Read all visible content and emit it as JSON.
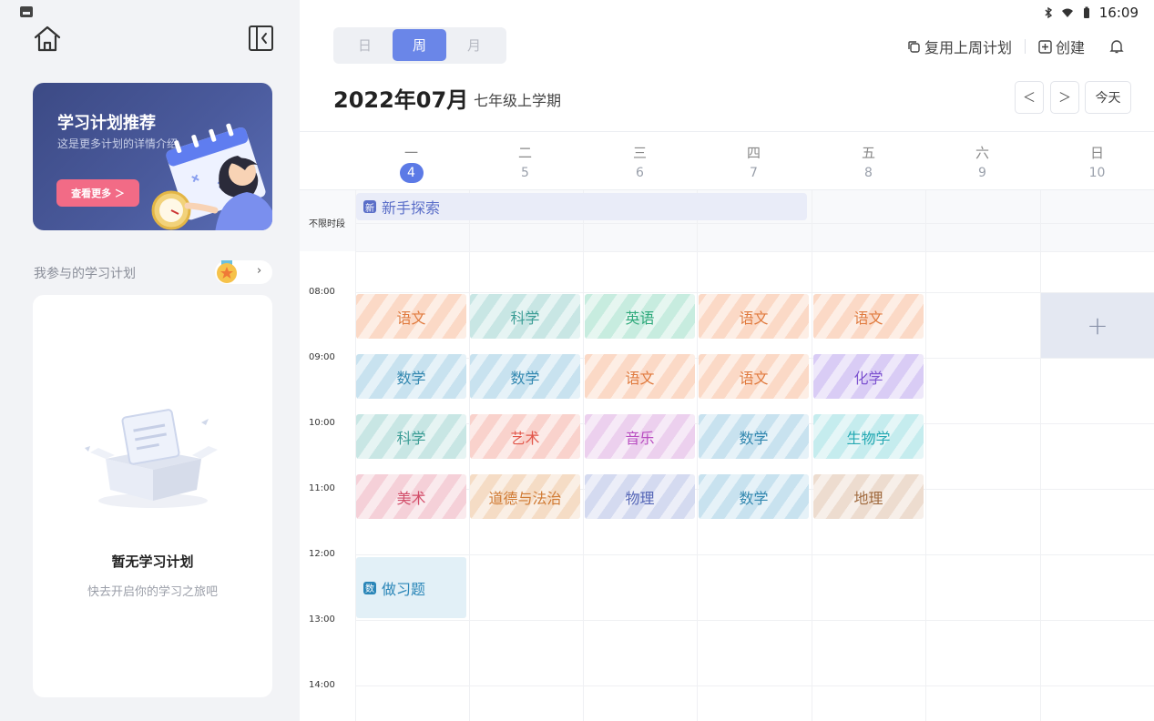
{
  "sidebar": {
    "banner": {
      "title": "学习计划推荐",
      "subtitle": "这是更多计划的详情介绍",
      "button": "查看更多 ＞"
    },
    "my_plans_label": "我参与的学习计划",
    "empty": {
      "title": "暂无学习计划",
      "subtitle": "快去开启你的学习之旅吧"
    }
  },
  "status": {
    "time": "16:09"
  },
  "view_tabs": [
    "日",
    "周",
    "月"
  ],
  "active_view": "周",
  "actions": {
    "reuse": "复用上周计划",
    "create": "创建"
  },
  "header": {
    "month": "2022年07月",
    "term": "七年级上学期",
    "prev": "＜",
    "next": "＞",
    "today": "今天"
  },
  "days": [
    {
      "name": "一",
      "num": "4",
      "today": true
    },
    {
      "name": "二",
      "num": "5"
    },
    {
      "name": "三",
      "num": "6"
    },
    {
      "name": "四",
      "num": "7"
    },
    {
      "name": "五",
      "num": "8"
    },
    {
      "name": "六",
      "num": "9"
    },
    {
      "name": "日",
      "num": "10"
    }
  ],
  "allday_label": "不限时段",
  "times": [
    "08:00",
    "09:00",
    "10:00",
    "11:00",
    "12:00",
    "13:00",
    "14:00"
  ],
  "allday_event": {
    "badge": "新",
    "title": "新手探索"
  },
  "lessons": [
    [
      "语文",
      "科学",
      "英语",
      "语文",
      "语文"
    ],
    [
      "数学",
      "数学",
      "语文",
      "语文",
      "化学"
    ],
    [
      "科学",
      "艺术",
      "音乐",
      "数学",
      "生物学"
    ],
    [
      "美术",
      "道德与法治",
      "物理",
      "数学",
      "地理"
    ]
  ],
  "lesson_colors": [
    [
      "#fbd9c6",
      "#c8e6e4",
      "#c7ecdf",
      "#fbd9c6",
      "#fbd9c6"
    ],
    [
      "#c8e2ef",
      "#c8e2ef",
      "#fbd9c6",
      "#fbd9c6",
      "#d9ccf5"
    ],
    [
      "#c8e6e4",
      "#f9d2cc",
      "#ecd0ee",
      "#c8e2ef",
      "#c5ecee"
    ],
    [
      "#f5d0d8",
      "#f5dcc5",
      "#d4daf0",
      "#c8e2ef",
      "#eddccf"
    ]
  ],
  "add_symbol": "+",
  "task_event": {
    "badge": "数",
    "title": "做习题"
  }
}
